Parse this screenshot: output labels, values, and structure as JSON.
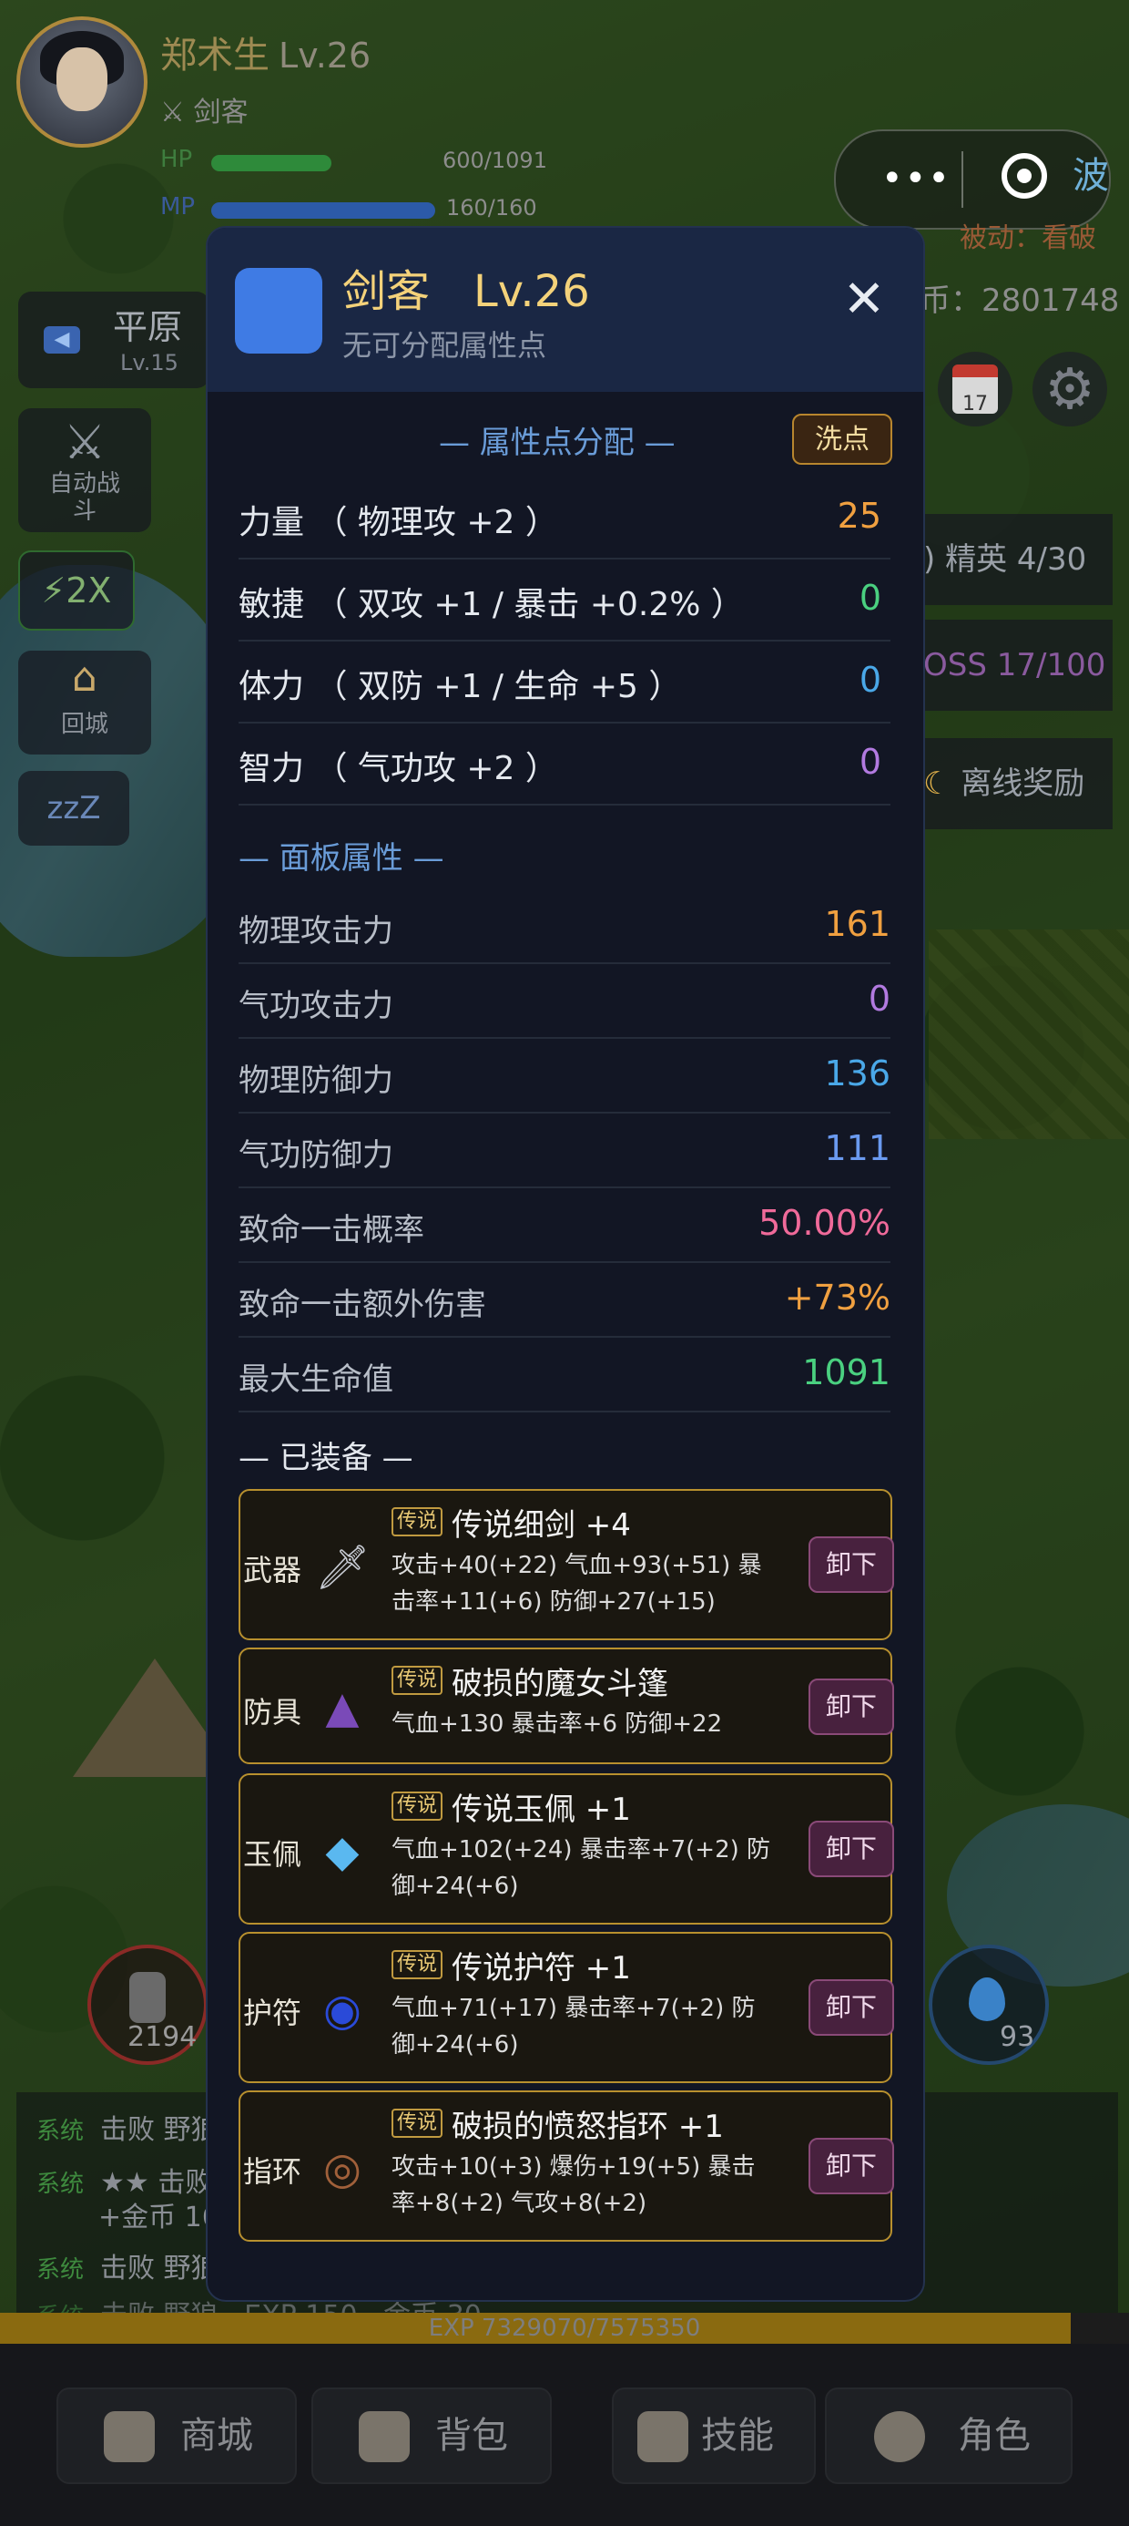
{
  "hud": {
    "player_name": "郑术生",
    "player_level": "Lv.26",
    "class_name": "剑客",
    "hp_label": "HP",
    "hp_value": "600/1091",
    "hp_ratio": 0.55,
    "mp_label": "MP",
    "mp_value": "160/160",
    "mp_ratio": 1.0,
    "wave_label": "第 波",
    "passive_text": "被动：看破",
    "gold_text": "币：2801748"
  },
  "left_controls": {
    "region_name": "平原",
    "region_level": "Lv.15",
    "auto_battle": "自动战斗",
    "speed": "⚡2X",
    "return_town": "回城",
    "sleep": "zzZ"
  },
  "right_controls": {
    "elite": "精英 4/30",
    "boss": "OSS 17/100",
    "offline": "离线奖励",
    "calendar_day": "17"
  },
  "potions": {
    "hp_count": "2194",
    "mp_count": "93"
  },
  "combat_log": [
    {
      "tag": "系统",
      "text": "击败 野狼"
    },
    {
      "tag": "系统",
      "text": "★★ 击败"
    },
    {
      "tag": "",
      "text": "+金币 16"
    },
    {
      "tag": "系统",
      "text": "击败 野狼"
    },
    {
      "tag": "系统",
      "text": "击败 野狼 · EXP 150 · 金币 30"
    }
  ],
  "exp": {
    "text": "EXP 7329070/7575350",
    "ratio": 0.968
  },
  "bottom_nav": [
    "商城",
    "背包",
    "技能",
    "角色"
  ],
  "modal": {
    "title": "剑客　Lv.26",
    "subtitle": "无可分配属性点",
    "close": "✕",
    "attr_section": "— 属性点分配 —",
    "reset_button": "洗点",
    "attributes": [
      {
        "label": "力量 （ 物理攻 +2 ）",
        "value": "25",
        "color": "#f0a040"
      },
      {
        "label": "敏捷 （ 双攻 +1 / 暴击 +0.2% ）",
        "value": "0",
        "color": "#4ad080"
      },
      {
        "label": "体力 （ 双防 +1 / 生命 +5 ）",
        "value": "0",
        "color": "#4aa8e8"
      },
      {
        "label": "智力 （ 气功攻 +2 ）",
        "value": "0",
        "color": "#b27ae0"
      }
    ],
    "panel_section": "— 面板属性 —",
    "panel_stats": [
      {
        "label": "物理攻击力",
        "value": "161",
        "color": "#f0a040"
      },
      {
        "label": "气功攻击力",
        "value": "0",
        "color": "#b27ae0"
      },
      {
        "label": "物理防御力",
        "value": "136",
        "color": "#4aa8e8"
      },
      {
        "label": "气功防御力",
        "value": "111",
        "color": "#6a9af0"
      },
      {
        "label": "致命一击概率",
        "value": "50.00%",
        "color": "#f06a9a"
      },
      {
        "label": "致命一击额外伤害",
        "value": "+73%",
        "color": "#f0a040"
      },
      {
        "label": "最大生命值",
        "value": "1091",
        "color": "#4ad080"
      }
    ],
    "equip_section": "— 已装备 —",
    "equipment": [
      {
        "slot": "武器",
        "icon": "sword-icon",
        "rarity": "传说",
        "name": "传说细剑 +4",
        "stats": "攻击+40(+22)  气血+93(+51)  暴击率+11(+6)  防御+27(+15)",
        "action": "卸下"
      },
      {
        "slot": "防具",
        "icon": "cloak-icon",
        "rarity": "传说",
        "name": "破损的魔女斗篷",
        "stats": "气血+130  暴击率+6  防御+22",
        "action": "卸下"
      },
      {
        "slot": "玉佩",
        "icon": "diamond-icon",
        "rarity": "传说",
        "name": "传说玉佩 +1",
        "stats": "气血+102(+24)  暴击率+7(+2)  防御+24(+6)",
        "action": "卸下"
      },
      {
        "slot": "护符",
        "icon": "amulet-icon",
        "rarity": "传说",
        "name": "传说护符 +1",
        "stats": "气血+71(+17)  暴击率+7(+2)  防御+24(+6)",
        "action": "卸下"
      },
      {
        "slot": "指环",
        "icon": "ring-icon",
        "rarity": "传说",
        "name": "破损的愤怒指环 +1",
        "stats": "攻击+10(+3)  爆伤+19(+5)  暴击率+8(+2)  气攻+8(+2)",
        "action": "卸下"
      }
    ]
  }
}
